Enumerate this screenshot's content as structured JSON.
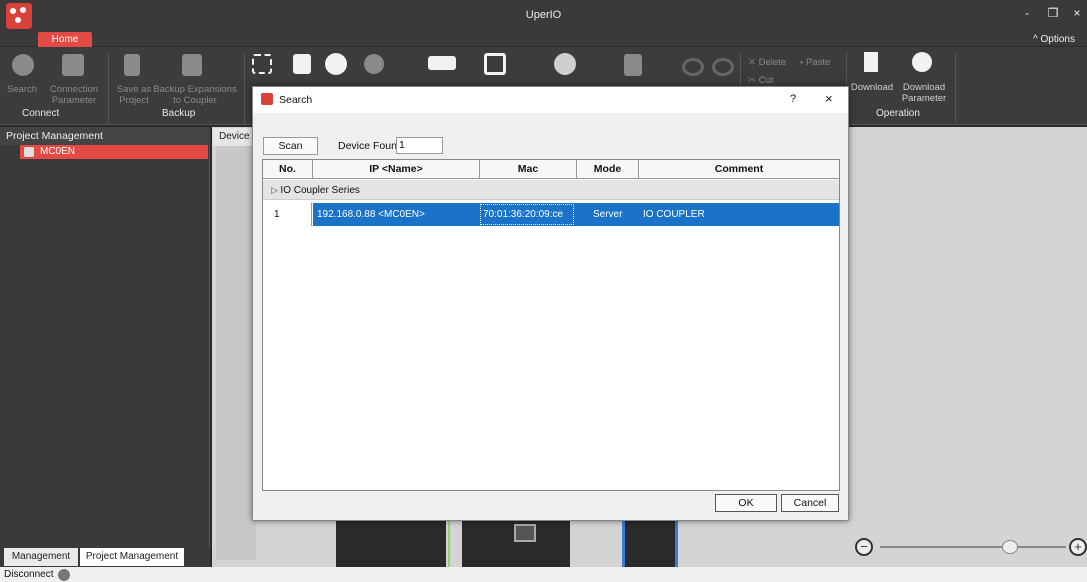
{
  "window": {
    "title": "UperIO",
    "minimize": "-",
    "restore": "❒",
    "close": "×"
  },
  "tabs": {
    "home": "Home",
    "options": "^  Options"
  },
  "ribbon": {
    "search": "Search",
    "connection_parameter": "Connection\nParameter",
    "save_as_project": "Save as\nProject",
    "backup_expansions": "Backup Expansions\nto Coupler",
    "delete": "Delete",
    "paste": "Paste",
    "cut": "Cut",
    "download": "Download",
    "download_parameter": "Download\nParameter",
    "groups": {
      "connect": "Connect",
      "backup": "Backup",
      "operation": "Operation"
    }
  },
  "left_panel": {
    "header": "Project Management",
    "item": "MC0EN",
    "bottom_tabs": [
      "Management",
      "Project Management"
    ]
  },
  "main": {
    "device_tab": "Device"
  },
  "status_bar": {
    "text": "Disconnect"
  },
  "dialog": {
    "title": "Search",
    "help": "?",
    "close": "×",
    "scan_button": "Scan",
    "device_found_label": "Device Found",
    "device_found_value": "1",
    "columns": [
      "No.",
      "IP <Name>",
      "Mac",
      "Mode",
      "Comment"
    ],
    "group": "IO Coupler Series",
    "rows": [
      {
        "no": "1",
        "ip": "192.168.0.88 <MC0EN>",
        "mac": "70:01:36:20:09:ce",
        "mode": "Server",
        "comment": "IO COUPLER"
      }
    ],
    "ok": "OK",
    "cancel": "Cancel"
  }
}
